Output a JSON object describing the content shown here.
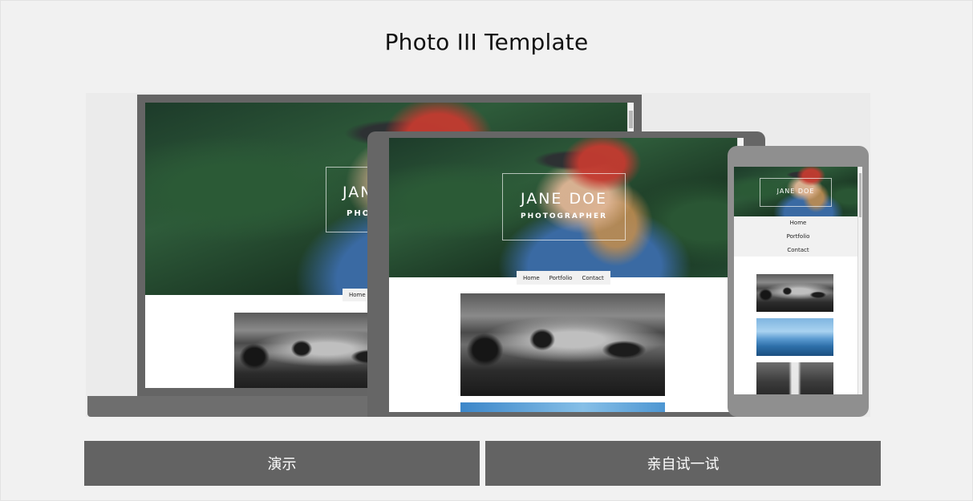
{
  "page": {
    "title": "Photo III Template"
  },
  "preview": {
    "hero_name": "JANE DOE",
    "hero_role": "PHOTOGRAPHER",
    "laptop_hero_name_partial": "JAN",
    "laptop_hero_role_partial": "PHO",
    "nav": {
      "home": "Home",
      "portfolio": "Portfolio",
      "contact": "Contact"
    }
  },
  "buttons": {
    "demo": "演示",
    "try_it": "亲自试一试"
  },
  "colors": {
    "background": "#f1f1f1",
    "button": "#636363",
    "device_dark": "#656565",
    "device_light": "#8f8f8f"
  }
}
